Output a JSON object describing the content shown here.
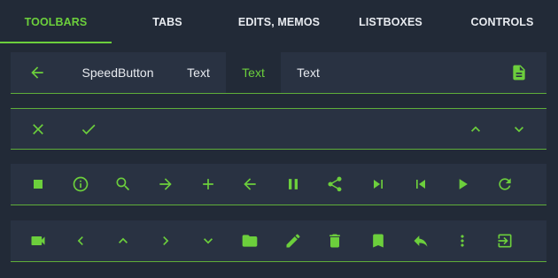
{
  "tabs": [
    {
      "label": "TOOLBARS",
      "active": true
    },
    {
      "label": "TABS",
      "active": false
    },
    {
      "label": "EDITS, MEMOS",
      "active": false
    },
    {
      "label": "LISTBOXES",
      "active": false
    },
    {
      "label": "CONTROLS",
      "active": false
    }
  ],
  "toolbar1": {
    "back_icon": "arrow-left-icon",
    "speed_button": "SpeedButton",
    "text_1": "Text",
    "text_2": "Text",
    "text_3": "Text",
    "doc_icon": "document-icon"
  },
  "toolbar2": {
    "icons": [
      "close-icon",
      "check-icon",
      "chevron-up-icon",
      "chevron-down-icon"
    ]
  },
  "toolbar3": {
    "icons": [
      "stop-icon",
      "info-icon",
      "search-icon",
      "arrow-right-icon",
      "plus-icon",
      "arrow-left-icon",
      "pause-icon",
      "share-icon",
      "skip-next-icon",
      "skip-previous-icon",
      "play-icon",
      "refresh-icon"
    ]
  },
  "toolbar4": {
    "icons": [
      "video-camera-icon",
      "chevron-left-icon",
      "chevron-up-icon",
      "chevron-right-icon",
      "chevron-down-icon",
      "folder-icon",
      "pencil-icon",
      "trash-icon",
      "bookmark-icon",
      "reply-icon",
      "more-vertical-icon",
      "exit-icon"
    ]
  },
  "colors": {
    "accent": "#6ccf3c",
    "background": "#222a37",
    "toolbar": "#293242",
    "text": "#e8ebf0"
  }
}
